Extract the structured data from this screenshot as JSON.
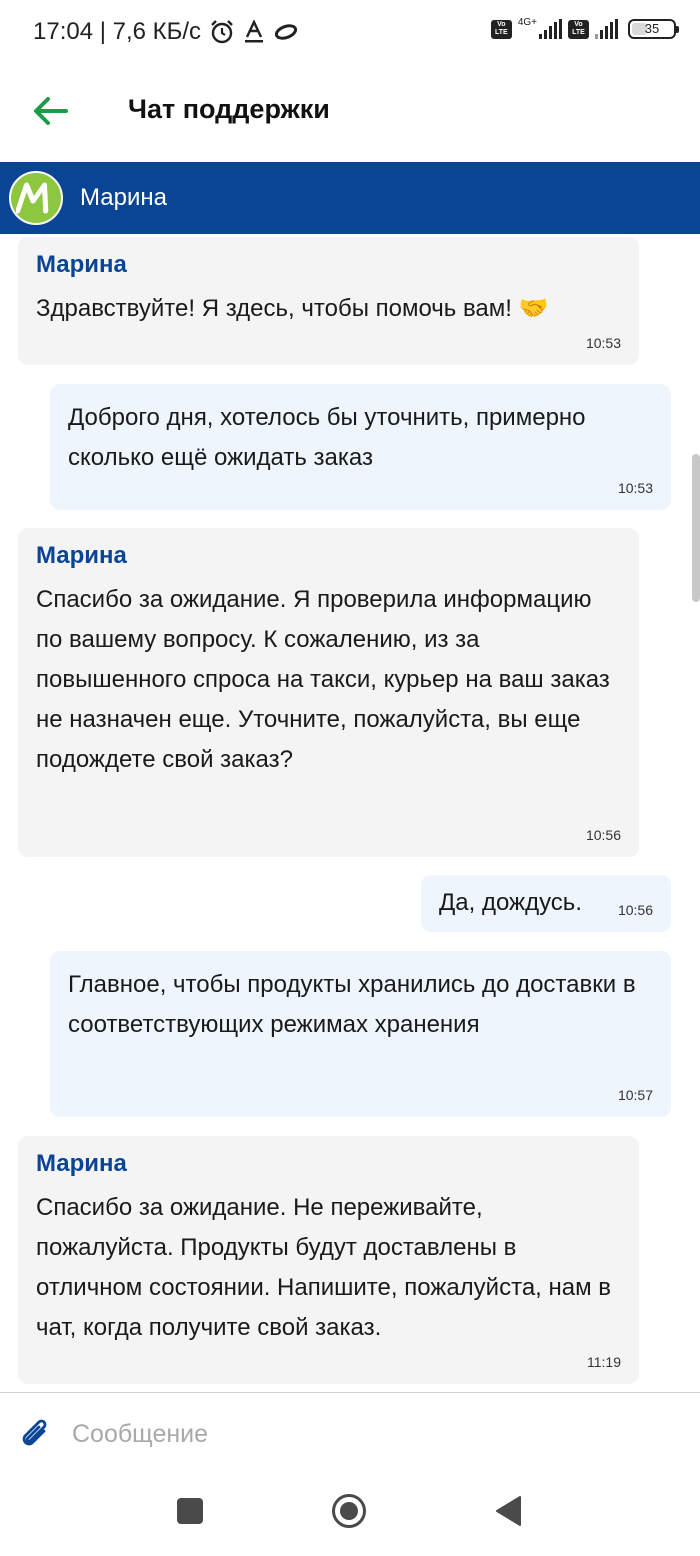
{
  "status_bar": {
    "time_speed": "17:04 | 7,6 КБ/с",
    "network_label": "4G+",
    "volte_label": "Vo LTE",
    "battery": "35"
  },
  "app_bar": {
    "title": "Чат поддержки",
    "back_icon": "arrow-left-icon"
  },
  "agent": {
    "name": "Марина",
    "avatar_letter": "M"
  },
  "messages": [
    {
      "from": "agent",
      "sender": "Марина",
      "text": "Здравствуйте! Я здесь, чтобы помочь вам! 🤝",
      "time": "10:53"
    },
    {
      "from": "user",
      "text": "Доброго дня, хотелось бы уточнить, примерно сколько ещё ожидать заказ",
      "time": "10:53"
    },
    {
      "from": "agent",
      "sender": "Марина",
      "text": "Спасибо за ожидание. Я проверила информацию по вашему вопросу. К сожалению, из за повышенного спроса на такси, курьер на ваш заказ не назначен еще. Уточните, пожалуйста, вы еще подождете свой заказ?",
      "time": "10:56"
    },
    {
      "from": "user",
      "text": "Да, дождусь.",
      "time": "10:56"
    },
    {
      "from": "user",
      "text": "Главное, чтобы продукты хранились до доставки в соответствующих режимах хранения",
      "time": "10:57"
    },
    {
      "from": "agent",
      "sender": "Марина",
      "text": "Спасибо за ожидание. Не переживайте, пожалуйста. Продукты будут доставлены в отличном состоянии. Напишите, пожалуйста, нам в чат, когда получите свой заказ.",
      "time": "11:19"
    }
  ],
  "input": {
    "placeholder": "Сообщение",
    "attach_icon": "paperclip-icon"
  },
  "colors": {
    "brand": "#0a4595",
    "accent_green": "#1a9d47",
    "avatar": "#8dc63f",
    "agent_bubble": "#f4f4f4",
    "user_bubble": "#eef5fd"
  }
}
